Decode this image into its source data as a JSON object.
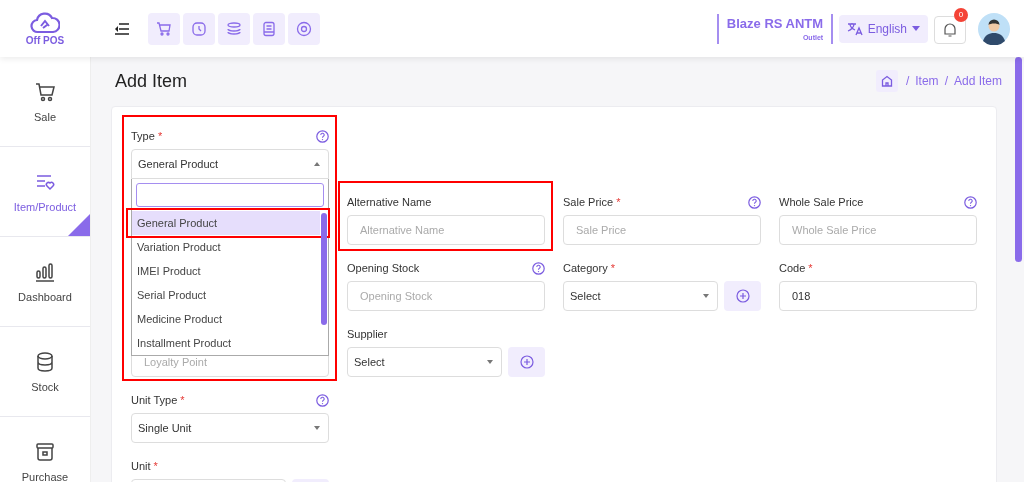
{
  "header": {
    "logo_text": "Off POS",
    "outlet": {
      "name": "Blaze RS ANTM",
      "label": "Outlet"
    },
    "language": "English",
    "notifications": {
      "count": "0"
    }
  },
  "sidebar": {
    "items": [
      {
        "label": "Sale",
        "selected": false
      },
      {
        "label": "Item/Product",
        "selected": true
      },
      {
        "label": "Dashboard",
        "selected": false
      },
      {
        "label": "Stock",
        "selected": false
      },
      {
        "label": "Purchase",
        "selected": false
      }
    ]
  },
  "page": {
    "title": "Add Item",
    "breadcrumb": [
      {
        "separator": "/",
        "label": "Item"
      },
      {
        "separator": "/",
        "label": "Add Item"
      }
    ]
  },
  "form": {
    "fields": [
      {
        "kind": "select",
        "label": "Type",
        "required_mark": "*",
        "help": true,
        "value": "General Product",
        "open": true,
        "highlighted": true,
        "options": [
          {
            "label": "General Product",
            "selected": true,
            "highlighted": true
          },
          {
            "label": "Variation Product",
            "selected": false
          },
          {
            "label": "IMEI Product",
            "selected": false
          },
          {
            "label": "Serial Product",
            "selected": false
          },
          {
            "label": "Medicine Product",
            "selected": false
          },
          {
            "label": "Installment Product",
            "selected": false
          }
        ]
      },
      {
        "kind": "text",
        "label": "Alternative Name",
        "placeholder": "Alternative Name",
        "highlighted": true
      },
      {
        "kind": "text",
        "label": "Sale Price",
        "required_mark": "*",
        "help": true,
        "placeholder": "Sale Price"
      },
      {
        "kind": "text",
        "label": "Whole Sale Price",
        "help": true,
        "placeholder": "Whole Sale Price"
      },
      {
        "kind": "text",
        "label": "Opening Stock",
        "help": true,
        "placeholder": "Opening Stock"
      },
      {
        "kind": "select",
        "label": "Category",
        "required_mark": "*",
        "value": "Select",
        "add_button": true
      },
      {
        "kind": "text",
        "label": "Code",
        "required_mark": "*",
        "value": "018"
      },
      {
        "kind": "text",
        "placeholder": "Loyalty Point"
      },
      {
        "kind": "select",
        "label": "Supplier",
        "value": "Select",
        "add_button": true
      },
      {
        "kind": "select",
        "label": "Unit Type",
        "required_mark": "*",
        "help": true,
        "value": "Single Unit"
      },
      {
        "kind": "select",
        "label": "Unit",
        "required_mark": "*",
        "add_button": true
      }
    ]
  }
}
